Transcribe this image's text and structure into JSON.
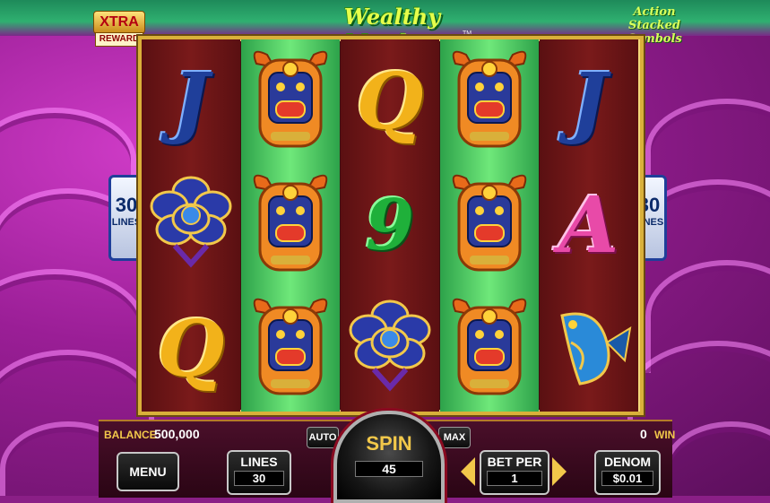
{
  "branding": {
    "xtra_top": "XTRA",
    "xtra_bottom": "REWARD",
    "game_title": "Wealthy Monkey",
    "tm": "TM",
    "feature_line1": "Action",
    "feature_line2": "Stacked",
    "feature_line3": "Symbols"
  },
  "side_badges": {
    "left": {
      "number": "30",
      "label": "LINES"
    },
    "right": {
      "number": "30",
      "label": "LINES"
    }
  },
  "reels": [
    {
      "bg": "red",
      "symbols": [
        "J",
        "flower",
        "Q"
      ]
    },
    {
      "bg": "green",
      "symbols": [
        "ox",
        "ox",
        "ox"
      ]
    },
    {
      "bg": "red",
      "symbols": [
        "Q",
        "9",
        "flower"
      ]
    },
    {
      "bg": "green",
      "symbols": [
        "ox",
        "ox",
        "ox"
      ]
    },
    {
      "bg": "red",
      "symbols": [
        "J",
        "A",
        "fish"
      ]
    }
  ],
  "controls": {
    "balance_label": "BALANCE",
    "balance_value": "500,000",
    "win_value": "0",
    "win_label": "WIN",
    "menu_label": "MENU",
    "lines_label": "LINES",
    "lines_value": "30",
    "auto_label": "AUTO",
    "max_label": "MAX",
    "spin_label": "SPIN",
    "spin_value": "45",
    "bet_per_label": "BET PER",
    "bet_per_value": "1",
    "denom_label": "DENOM",
    "denom_value": "$0.01"
  },
  "colors": {
    "accent_gold": "#f2c84a",
    "frame_gold": "#d9b03a",
    "reel_red": "#7a1a1a",
    "reel_green": "#6fe87a"
  }
}
